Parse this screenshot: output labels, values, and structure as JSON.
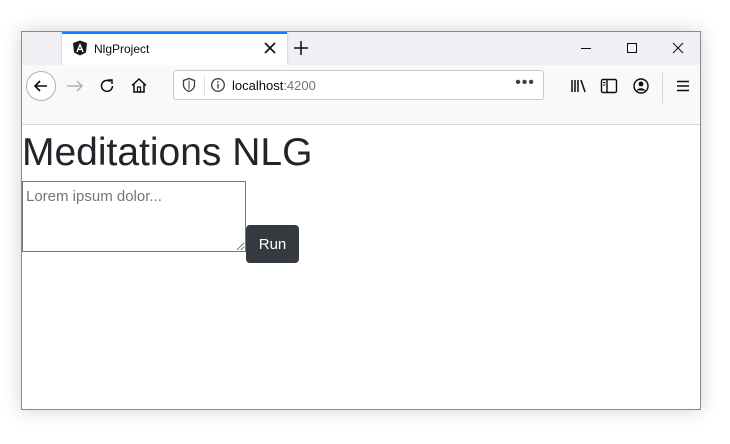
{
  "browser": {
    "tab": {
      "title": "NlgProject",
      "favicon": "angular-logo-icon"
    },
    "url": {
      "host": "localhost",
      "port": ":4200"
    },
    "colors": {
      "tab_accent": "#0a84ff",
      "titlebar_bg": "#f0f0f4"
    }
  },
  "page": {
    "title": "Meditations NLG",
    "input": {
      "placeholder": "Lorem ipsum dolor...",
      "value": ""
    },
    "run_button_label": "Run",
    "colors": {
      "button_bg": "#343a40",
      "button_text": "#ffffff",
      "heading_text": "#212529"
    }
  }
}
